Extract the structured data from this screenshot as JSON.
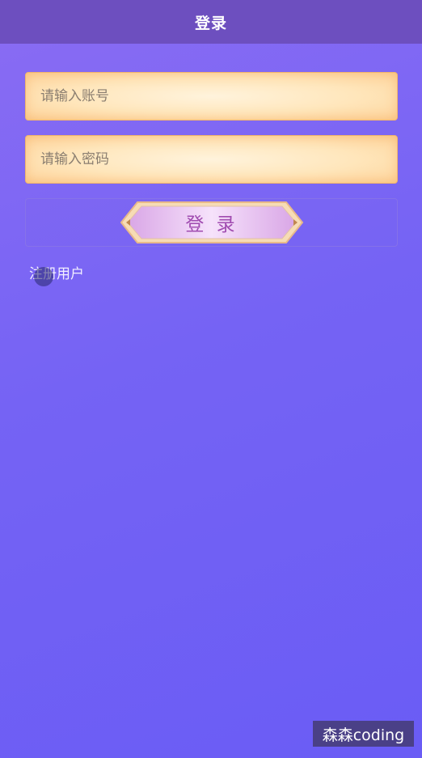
{
  "header": {
    "title": "登录"
  },
  "form": {
    "account_placeholder": "请输入账号",
    "password_placeholder": "请输入密码",
    "login_label": "登 录",
    "register_label": "注册用户"
  },
  "watermark": "森森coding",
  "colors": {
    "header_bg": "#6d4fbf",
    "input_bg": "#ffe6bb",
    "button_text": "#a04bb0"
  }
}
